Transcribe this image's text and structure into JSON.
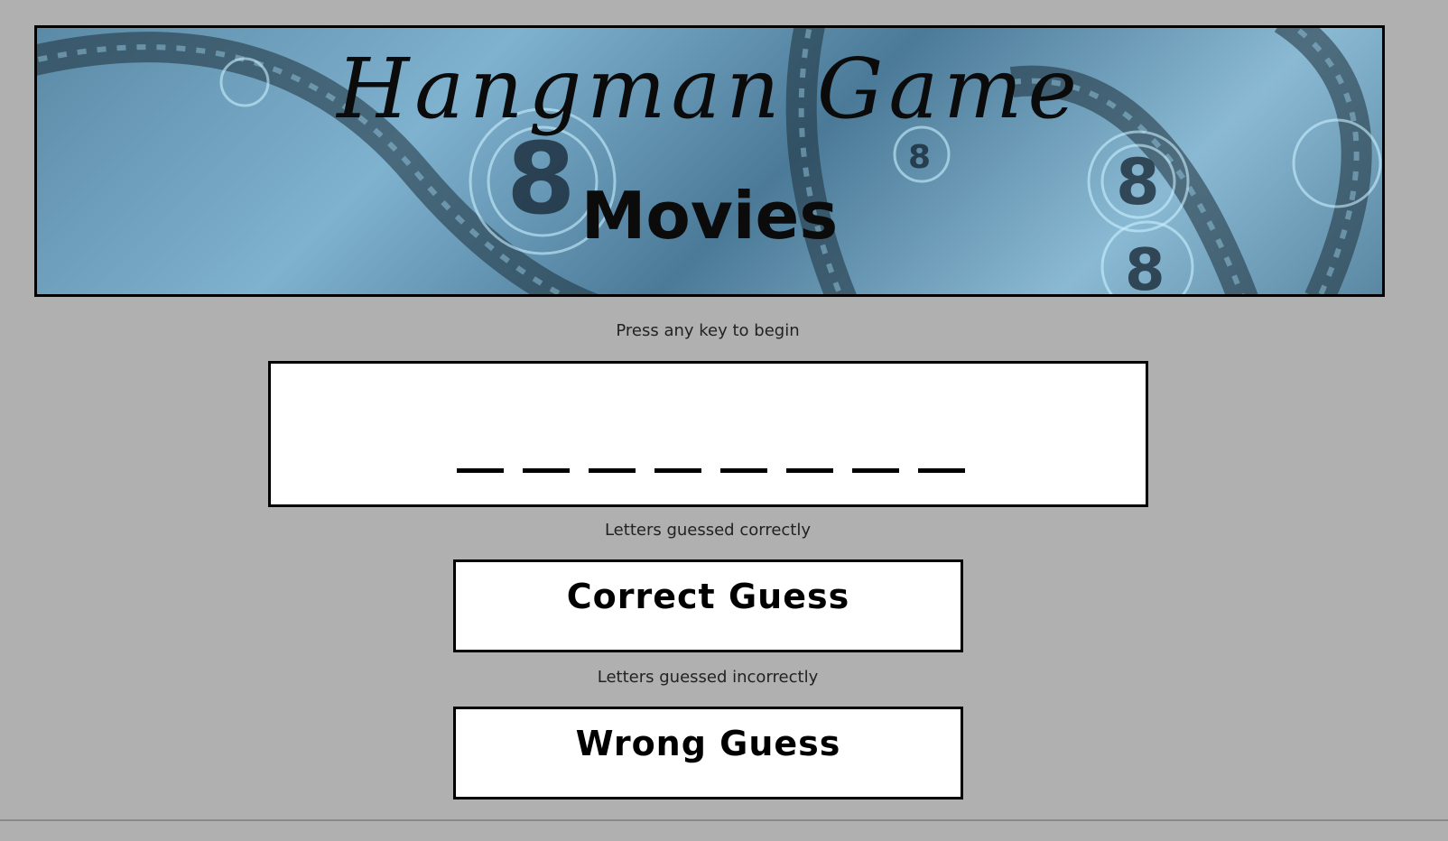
{
  "banner": {
    "title": "Hangman Game",
    "subtitle": "Movies"
  },
  "instructions": {
    "start_prompt": "Press any key to begin"
  },
  "word": {
    "blank_count": 8
  },
  "correct": {
    "caption": "Letters guessed correctly",
    "label": "Correct Guess"
  },
  "wrong": {
    "caption": "Letters guessed incorrectly",
    "label": "Wrong Guess"
  }
}
